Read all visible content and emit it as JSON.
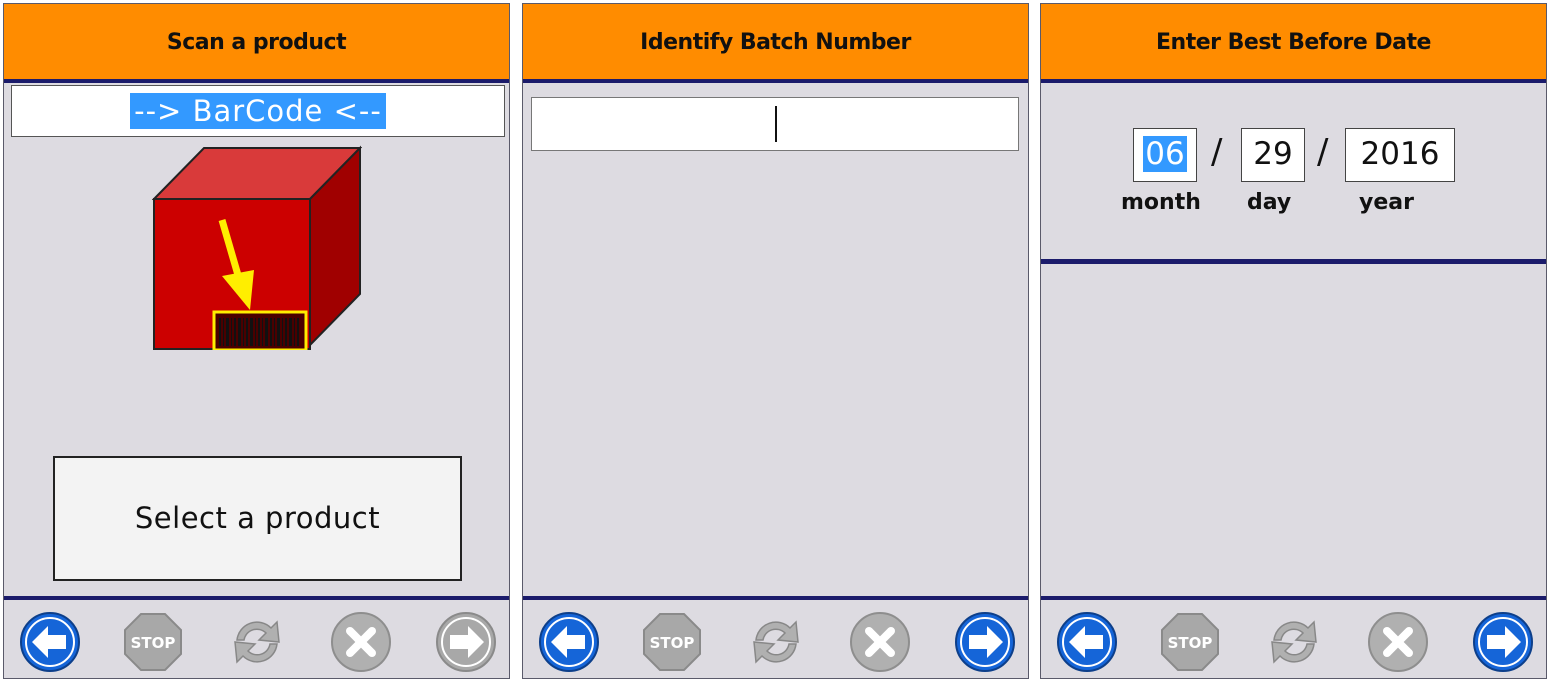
{
  "panels": [
    {
      "title": "Scan a product",
      "barcode_field": "--> BarCode <--",
      "select_button": "Select a product"
    },
    {
      "title": "Identify Batch Number",
      "batch_input_value": ""
    },
    {
      "title": "Enter Best Before Date",
      "date": {
        "month": "06",
        "day": "29",
        "year": "2016",
        "month_label": "month",
        "day_label": "day",
        "year_label": "year",
        "separator": "/"
      }
    }
  ],
  "toolbar": {
    "stop_label": "STOP",
    "icons": [
      "back-arrow-icon",
      "stop-icon",
      "refresh-icon",
      "cancel-icon",
      "forward-arrow-icon"
    ]
  },
  "colors": {
    "header": "#ff8c00",
    "divider": "#1b1b6b",
    "panel_bg": "#dddbe1",
    "active_button": "#1565d8",
    "disabled_button": "#a8a8a8",
    "selection": "#3399ff",
    "box_red": "#cc0000",
    "arrow_yellow": "#ffee00"
  }
}
